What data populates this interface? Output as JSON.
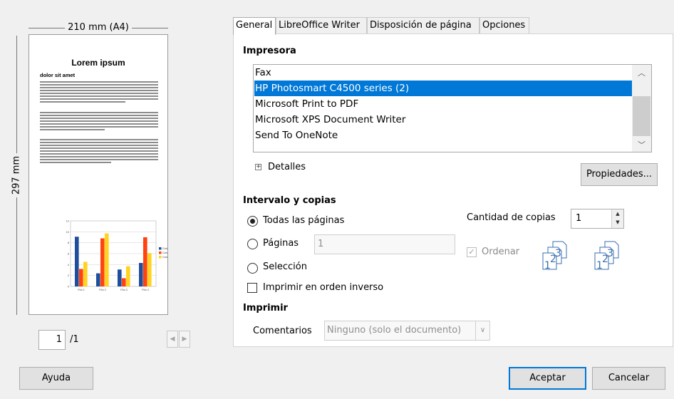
{
  "preview": {
    "width_label": "210 mm (A4)",
    "height_label": "297 mm",
    "doc_title": "Lorem ipsum",
    "doc_subtitle": "dolor sit amet",
    "current_page": "1",
    "total_pages": "/1"
  },
  "preview_chart": {
    "type": "bar",
    "categories": [
      "Fila 1",
      "Fila 2",
      "Fila 3",
      "Fila 4"
    ],
    "series": [
      {
        "name": "Columna 1",
        "color": "#1f4e9c",
        "values": [
          9.1,
          2.4,
          3.1,
          4.3
        ]
      },
      {
        "name": "Columna 2",
        "color": "#ff420e",
        "values": [
          3.2,
          8.8,
          1.5,
          9.0
        ]
      },
      {
        "name": "Columna 3",
        "color": "#ffd320",
        "values": [
          4.5,
          9.7,
          3.7,
          6.1
        ]
      }
    ],
    "yticks": [
      "0",
      "2",
      "4",
      "6",
      "8",
      "10",
      "12"
    ],
    "ylim": [
      0,
      12
    ]
  },
  "tabs": [
    "General",
    "LibreOffice Writer",
    "Disposición de página",
    "Opciones"
  ],
  "printer": {
    "header": "Impresora",
    "items": [
      "Fax",
      "HP Photosmart C4500 series (2)",
      "Microsoft Print to PDF",
      "Microsoft XPS Document Writer",
      "Send To OneNote"
    ],
    "selected_index": 1,
    "details_label": "Detalles",
    "properties_label": "Propiedades..."
  },
  "range": {
    "header": "Intervalo y copias",
    "all_pages": "Todas las páginas",
    "pages": "Páginas",
    "pages_value": "1",
    "selection": "Selección",
    "reverse": "Imprimir en orden inverso",
    "copies_label": "Cantidad de copias",
    "copies_value": "1",
    "collate_label": "Ordenar"
  },
  "print": {
    "header": "Imprimir",
    "comments_label": "Comentarios",
    "comments_value": "Ninguno (solo el documento)"
  },
  "buttons": {
    "help": "Ayuda",
    "ok": "Aceptar",
    "cancel": "Cancelar"
  }
}
